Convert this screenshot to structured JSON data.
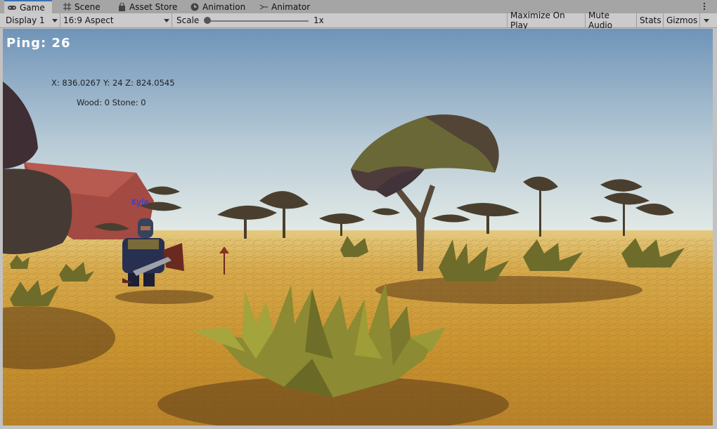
{
  "tabs": [
    {
      "label": "Game",
      "icon": "gamepad-icon",
      "active": true
    },
    {
      "label": "Scene",
      "icon": "grid-icon"
    },
    {
      "label": "Asset Store",
      "icon": "shopping-bag-icon"
    },
    {
      "label": "Animation",
      "icon": "clock-icon"
    },
    {
      "label": "Animator",
      "icon": "animator-icon"
    }
  ],
  "toolbar": {
    "display": "Display 1",
    "aspect": "16:9 Aspect",
    "scale_label": "Scale",
    "scale_value": "1x",
    "scale_fraction": 0.0,
    "maximize": "Maximize On Play",
    "mute": "Mute Audio",
    "stats": "Stats",
    "gizmos": "Gizmos"
  },
  "hud": {
    "ping": "Ping: 26",
    "coords": "X: 836.0267 Y: 24 Z: 824.0545",
    "resources": "Wood: 0 Stone: 0",
    "player_name": "Kyle"
  },
  "colors": {
    "accent": "#3a72b0",
    "sky_top": "#6d93b6",
    "sky_horizon": "#dfe7e4",
    "ground": "#c9962f",
    "player_name": "#2f3bd9"
  }
}
